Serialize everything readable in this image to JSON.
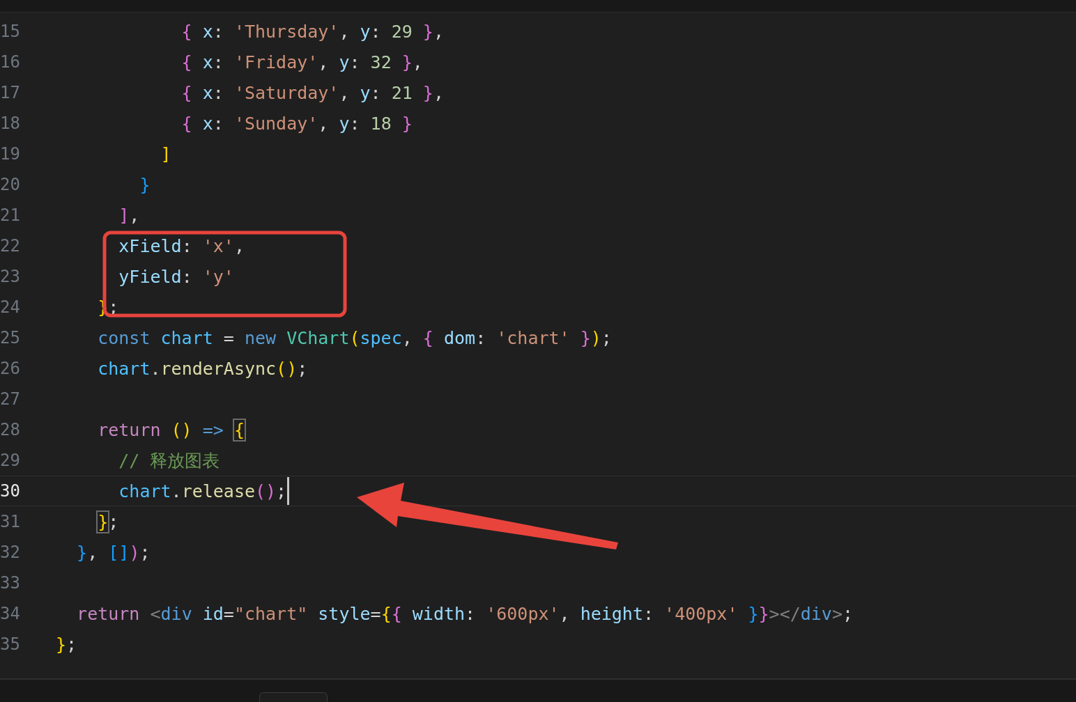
{
  "editor": {
    "lines": [
      {
        "number": "15",
        "current": false,
        "tokens": [
          {
            "kind": "b2",
            "text": "            {"
          },
          {
            "kind": "prop",
            "text": " x"
          },
          {
            "kind": "p",
            "text": ": "
          },
          {
            "kind": "str",
            "text": "'Thursday'"
          },
          {
            "kind": "p",
            "text": ", "
          },
          {
            "kind": "prop",
            "text": "y"
          },
          {
            "kind": "p",
            "text": ": "
          },
          {
            "kind": "num",
            "text": "29"
          },
          {
            "kind": "b2",
            "text": " }"
          },
          {
            "kind": "p",
            "text": ","
          }
        ]
      },
      {
        "number": "16",
        "current": false,
        "tokens": [
          {
            "kind": "b2",
            "text": "            {"
          },
          {
            "kind": "prop",
            "text": " x"
          },
          {
            "kind": "p",
            "text": ": "
          },
          {
            "kind": "str",
            "text": "'Friday'"
          },
          {
            "kind": "p",
            "text": ", "
          },
          {
            "kind": "prop",
            "text": "y"
          },
          {
            "kind": "p",
            "text": ": "
          },
          {
            "kind": "num",
            "text": "32"
          },
          {
            "kind": "b2",
            "text": " }"
          },
          {
            "kind": "p",
            "text": ","
          }
        ]
      },
      {
        "number": "17",
        "current": false,
        "tokens": [
          {
            "kind": "b2",
            "text": "            {"
          },
          {
            "kind": "prop",
            "text": " x"
          },
          {
            "kind": "p",
            "text": ": "
          },
          {
            "kind": "str",
            "text": "'Saturday'"
          },
          {
            "kind": "p",
            "text": ", "
          },
          {
            "kind": "prop",
            "text": "y"
          },
          {
            "kind": "p",
            "text": ": "
          },
          {
            "kind": "num",
            "text": "21"
          },
          {
            "kind": "b2",
            "text": " }"
          },
          {
            "kind": "p",
            "text": ","
          }
        ]
      },
      {
        "number": "18",
        "current": false,
        "tokens": [
          {
            "kind": "b2",
            "text": "            {"
          },
          {
            "kind": "prop",
            "text": " x"
          },
          {
            "kind": "p",
            "text": ": "
          },
          {
            "kind": "str",
            "text": "'Sunday'"
          },
          {
            "kind": "p",
            "text": ", "
          },
          {
            "kind": "prop",
            "text": "y"
          },
          {
            "kind": "p",
            "text": ": "
          },
          {
            "kind": "num",
            "text": "18"
          },
          {
            "kind": "b2",
            "text": " }"
          }
        ]
      },
      {
        "number": "19",
        "current": false,
        "tokens": [
          {
            "kind": "b1",
            "text": "          ]"
          }
        ]
      },
      {
        "number": "20",
        "current": false,
        "tokens": [
          {
            "kind": "b3",
            "text": "        }"
          }
        ]
      },
      {
        "number": "21",
        "current": false,
        "tokens": [
          {
            "kind": "b2",
            "text": "      ]"
          },
          {
            "kind": "p",
            "text": ","
          }
        ]
      },
      {
        "number": "22",
        "current": false,
        "tokens": [
          {
            "kind": "prop",
            "text": "      xField"
          },
          {
            "kind": "p",
            "text": ": "
          },
          {
            "kind": "str",
            "text": "'x'"
          },
          {
            "kind": "p",
            "text": ","
          }
        ]
      },
      {
        "number": "23",
        "current": false,
        "tokens": [
          {
            "kind": "prop",
            "text": "      yField"
          },
          {
            "kind": "p",
            "text": ": "
          },
          {
            "kind": "str",
            "text": "'y'"
          }
        ]
      },
      {
        "number": "24",
        "current": false,
        "tokens": [
          {
            "kind": "b1",
            "text": "    }"
          },
          {
            "kind": "p",
            "text": ";"
          }
        ]
      },
      {
        "number": "25",
        "current": false,
        "tokens": [
          {
            "kind": "st",
            "text": "    const"
          },
          {
            "kind": "var",
            "text": " chart"
          },
          {
            "kind": "p",
            "text": " = "
          },
          {
            "kind": "st",
            "text": "new"
          },
          {
            "kind": "cls",
            "text": " VChart"
          },
          {
            "kind": "b1",
            "text": "("
          },
          {
            "kind": "var",
            "text": "spec"
          },
          {
            "kind": "p",
            "text": ", "
          },
          {
            "kind": "b2",
            "text": "{"
          },
          {
            "kind": "prop",
            "text": " dom"
          },
          {
            "kind": "p",
            "text": ": "
          },
          {
            "kind": "str",
            "text": "'chart'"
          },
          {
            "kind": "b2",
            "text": " }"
          },
          {
            "kind": "b1",
            "text": ")"
          },
          {
            "kind": "p",
            "text": ";"
          }
        ]
      },
      {
        "number": "26",
        "current": false,
        "tokens": [
          {
            "kind": "var",
            "text": "    chart"
          },
          {
            "kind": "p",
            "text": "."
          },
          {
            "kind": "fn",
            "text": "renderAsync"
          },
          {
            "kind": "b1",
            "text": "()"
          },
          {
            "kind": "p",
            "text": ";"
          }
        ]
      },
      {
        "number": "27",
        "current": false
      },
      {
        "number": "28",
        "current": false,
        "tokens": [
          {
            "kind": "kw",
            "text": "    return"
          },
          {
            "kind": "b1",
            "text": " ()"
          },
          {
            "kind": "st",
            "text": " => "
          },
          {
            "kind": "bm",
            "text": "{"
          }
        ]
      },
      {
        "number": "29",
        "current": false,
        "tokens": [
          {
            "kind": "cm",
            "text": "      // 释放图表"
          }
        ]
      },
      {
        "number": "30",
        "current": true,
        "tokens": [
          {
            "kind": "var",
            "text": "      chart"
          },
          {
            "kind": "p",
            "text": "."
          },
          {
            "kind": "fn",
            "text": "release"
          },
          {
            "kind": "b2",
            "text": "()"
          },
          {
            "kind": "p",
            "text": ";"
          }
        ]
      },
      {
        "number": "31",
        "current": false,
        "tokens": [
          {
            "kind": "bm",
            "text": "    }"
          },
          {
            "kind": "p",
            "text": ";"
          }
        ]
      },
      {
        "number": "32",
        "current": false,
        "tokens": [
          {
            "kind": "b3",
            "text": "  }"
          },
          {
            "kind": "p",
            "text": ", "
          },
          {
            "kind": "b3",
            "text": "[]"
          },
          {
            "kind": "b2",
            "text": ")"
          },
          {
            "kind": "p",
            "text": ";"
          }
        ]
      },
      {
        "number": "33",
        "current": false
      },
      {
        "number": "34",
        "current": false,
        "tokens": [
          {
            "kind": "kw",
            "text": "  return"
          },
          {
            "kind": "gray",
            "text": " <"
          },
          {
            "kind": "tag",
            "text": "div"
          },
          {
            "kind": "prop",
            "text": " id"
          },
          {
            "kind": "p",
            "text": "="
          },
          {
            "kind": "str",
            "text": "\"chart\""
          },
          {
            "kind": "prop",
            "text": " style"
          },
          {
            "kind": "p",
            "text": "="
          },
          {
            "kind": "b1",
            "text": "{"
          },
          {
            "kind": "b2",
            "text": "{"
          },
          {
            "kind": "prop",
            "text": " width"
          },
          {
            "kind": "p",
            "text": ": "
          },
          {
            "kind": "str",
            "text": "'600px'"
          },
          {
            "kind": "p",
            "text": ", "
          },
          {
            "kind": "prop",
            "text": "height"
          },
          {
            "kind": "p",
            "text": ": "
          },
          {
            "kind": "str",
            "text": "'400px'"
          },
          {
            "kind": "b3",
            "text": " }"
          },
          {
            "kind": "b2",
            "text": "}"
          },
          {
            "kind": "gray",
            "text": "></"
          },
          {
            "kind": "tag",
            "text": "div"
          },
          {
            "kind": "gray",
            "text": ">"
          },
          {
            "kind": "p",
            "text": ";"
          }
        ]
      },
      {
        "number": "35",
        "current": false,
        "tokens": [
          {
            "kind": "b1",
            "text": "}"
          },
          {
            "kind": "p",
            "text": ";"
          }
        ]
      }
    ]
  }
}
